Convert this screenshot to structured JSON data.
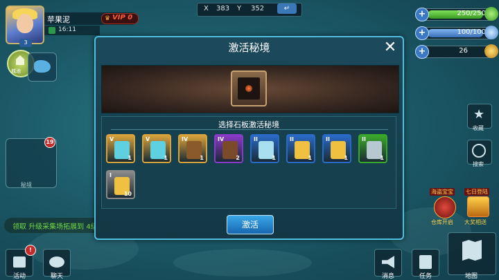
{
  "player": {
    "name": "苹果泥",
    "vip": "VIP 0",
    "level": "3",
    "time": "16:11"
  },
  "coords": {
    "x_label": "X",
    "x_value": "383",
    "y_label": "Y",
    "y_value": "352",
    "go_symbol": "↵"
  },
  "resources": [
    {
      "value": "250/250",
      "color": "#5cc23a",
      "fill": 1.0
    },
    {
      "value": "100/100",
      "color": "#5c9ae0",
      "fill": 1.0
    },
    {
      "value": "26",
      "color": "#e0a82a"
    }
  ],
  "modal": {
    "title": "激活秘境",
    "close_symbol": "✕",
    "select_title": "选择石板激活秘境",
    "activate_label": "激活",
    "items": [
      {
        "tier": "V",
        "count": "1",
        "frame": "#d9a23a",
        "art": "#5fd0e0"
      },
      {
        "tier": "V",
        "count": "1",
        "frame": "#d9a23a",
        "art": "#5fd0e0"
      },
      {
        "tier": "IV",
        "count": "1",
        "frame": "#d9a23a",
        "art": "#8a5a2a"
      },
      {
        "tier": "IV",
        "count": "2",
        "frame": "#8a3ac8",
        "art": "#7a4a2a"
      },
      {
        "tier": "II",
        "count": "1",
        "frame": "#2a6ac8",
        "art": "#a9e0f0"
      },
      {
        "tier": "II",
        "count": "1",
        "frame": "#2a6ac8",
        "art": "#f0c040"
      },
      {
        "tier": "II",
        "count": "1",
        "frame": "#2a6ac8",
        "art": "#f0c040"
      },
      {
        "tier": "II",
        "count": "1",
        "frame": "#3aa82a",
        "art": "#b8c8d0"
      },
      {
        "tier": "I",
        "count": "10",
        "frame": "#8a8a8a",
        "art": "#f0c040"
      }
    ]
  },
  "left": {
    "minimap_badge": "19",
    "minimap_label": "秘境",
    "quest_text": "领取 升级采集场拓展到 4级",
    "city_label": "城池"
  },
  "bottom_left": [
    {
      "label": "活动",
      "icon": "gift-icon",
      "badge": "!"
    },
    {
      "label": "聊天",
      "icon": "chat-icon"
    }
  ],
  "bottom_right": [
    {
      "label": "消息",
      "icon": "horn-icon"
    },
    {
      "label": "任务",
      "icon": "task-icon"
    },
    {
      "label": "地图",
      "icon": "map-icon"
    }
  ],
  "right_side": [
    {
      "label": "收藏",
      "icon": "star-icon"
    },
    {
      "label": "搜索",
      "icon": "compass-icon"
    }
  ],
  "events": [
    {
      "tag": "海盗宝宝",
      "label": "仓库开启"
    },
    {
      "tag": "七日登陆",
      "label": "大奖相送"
    }
  ]
}
